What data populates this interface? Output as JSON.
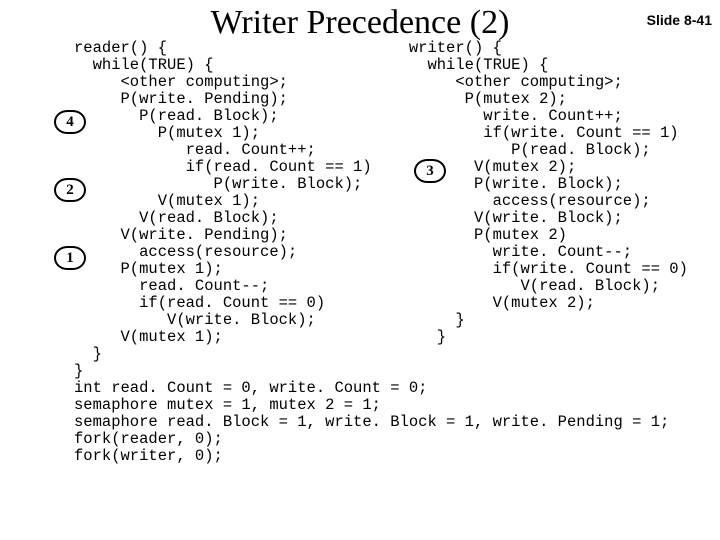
{
  "title": "Writer Precedence (2)",
  "slide_number": "Slide 8-41",
  "badges": {
    "b1": "1",
    "b2": "2",
    "b3": "3",
    "b4": "4"
  },
  "code": {
    "l01": "reader() {                          writer() {",
    "l02": "  while(TRUE) {                       while(TRUE) {",
    "l03": "     <other computing>;                  <other computing>;",
    "l04": "     P(write. Pending);                   P(mutex 2);",
    "l05": "       P(read. Block);                      write. Count++;",
    "l06": "         P(mutex 1);                        if(write. Count == 1)",
    "l07": "            read. Count++;                     P(read. Block);",
    "l08": "            if(read. Count == 1)           V(mutex 2);",
    "l09": "               P(write. Block);            P(write. Block);",
    "l10": "         V(mutex 1);                         access(resource);",
    "l11": "       V(read. Block);                     V(write. Block);",
    "l12": "     V(write. Pending);                    P(mutex 2)",
    "l13": "       access(resource);                     write. Count--;",
    "l14": "     P(mutex 1);                             if(write. Count == 0)",
    "l15": "       read. Count--;                           V(read. Block);",
    "l16": "       if(read. Count == 0)                  V(mutex 2);",
    "l17": "          V(write. Block);               }",
    "l18": "     V(mutex 1);                       }",
    "l19": "  }",
    "l20": "}",
    "l21": "int read. Count = 0, write. Count = 0;",
    "l22": "semaphore mutex = 1, mutex 2 = 1;",
    "l23": "semaphore read. Block = 1, write. Block = 1, write. Pending = 1;",
    "l24": "fork(reader, 0);",
    "l25": "fork(writer, 0);"
  }
}
